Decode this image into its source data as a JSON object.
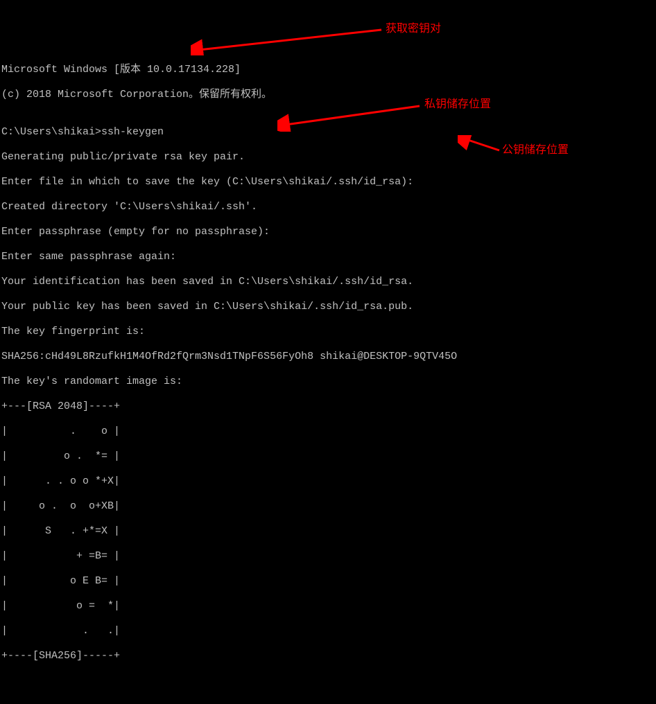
{
  "terminal": {
    "lines": [
      "Microsoft Windows [版本 10.0.17134.228]",
      "(c) 2018 Microsoft Corporation。保留所有权利。",
      "",
      "C:\\Users\\shikai>ssh-keygen",
      "Generating public/private rsa key pair.",
      "Enter file in which to save the key (C:\\Users\\shikai/.ssh/id_rsa):",
      "Created directory 'C:\\Users\\shikai/.ssh'.",
      "Enter passphrase (empty for no passphrase):",
      "Enter same passphrase again:",
      "Your identification has been saved in C:\\Users\\shikai/.ssh/id_rsa.",
      "Your public key has been saved in C:\\Users\\shikai/.ssh/id_rsa.pub.",
      "The key fingerprint is:",
      "SHA256:cHd49L8RzufkH1M4OfRd2fQrm3Nsd1TNpF6S56FyOh8 shikai@DESKTOP-9QTV45O",
      "The key's randomart image is:",
      "+---[RSA 2048]----+",
      "|          .    o |",
      "|         o .  *= |",
      "|      . . o o *+X|",
      "|     o .  o  o+XB|",
      "|      S   . +*=X |",
      "|           + =B= |",
      "|          o E B= |",
      "|           o =  *|",
      "|            .   .|",
      "+----[SHA256]-----+"
    ]
  },
  "annotations": {
    "keypair": "获取密钥对",
    "private_key": "私钥储存位置",
    "public_key": "公钥储存位置"
  }
}
